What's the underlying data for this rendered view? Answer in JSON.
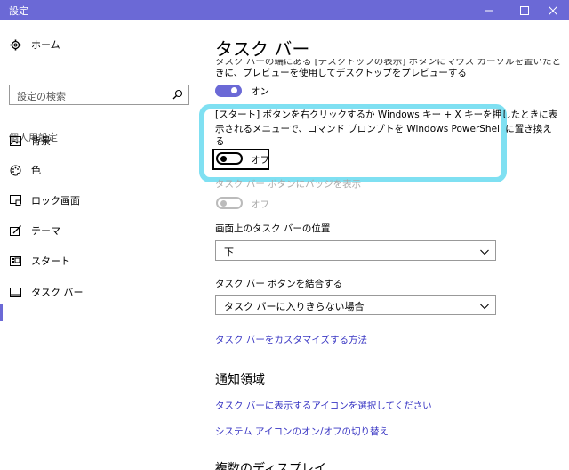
{
  "window": {
    "title": "設定"
  },
  "sidebar": {
    "home_label": "ホーム",
    "search_placeholder": "設定の検索",
    "section_header": "個人用設定",
    "items": [
      {
        "label": "背景",
        "icon": "picture-icon"
      },
      {
        "label": "色",
        "icon": "palette-icon"
      },
      {
        "label": "ロック画面",
        "icon": "lock-screen-icon"
      },
      {
        "label": "テーマ",
        "icon": "theme-icon"
      },
      {
        "label": "スタート",
        "icon": "start-icon"
      },
      {
        "label": "タスク バー",
        "icon": "taskbar-icon",
        "selected": true
      }
    ]
  },
  "main": {
    "page_title": "タスク バー",
    "peek": {
      "desc_line1": "タスク バーの端にある [デスクトップの表示] ボタンにマウス カーソルを置いたと",
      "desc_line2": "きに、プレビューを使用してデスクトップをプレビューする",
      "state": "オン"
    },
    "powershell": {
      "desc_line1": "[スタート] ボタンを右クリックするか Windows キー + X キーを押したときに表",
      "desc_line2": "示されるメニューで、コマンド プロンプトを Windows PowerShell に置き換え",
      "desc_line3": "る",
      "state": "オフ"
    },
    "badges": {
      "desc": "タスク バー ボタンにバッジを表示",
      "state": "オフ"
    },
    "position": {
      "label": "画面上のタスク バーの位置",
      "value": "下"
    },
    "combine": {
      "label": "タスク バー ボタンを結合する",
      "value": "タスク バーに入りきらない場合"
    },
    "link_customize": "タスク バーをカスタマイズする方法",
    "notification": {
      "heading": "通知領域",
      "link1": "タスク バーに表示するアイコンを選択してください",
      "link2": "システム アイコンのオン/オフの切り替え"
    },
    "multi_heading": "複数のディスプレイ"
  },
  "colors": {
    "accent": "#6b69d6",
    "highlight": "#7fe0f2",
    "link": "#3a37c4"
  }
}
